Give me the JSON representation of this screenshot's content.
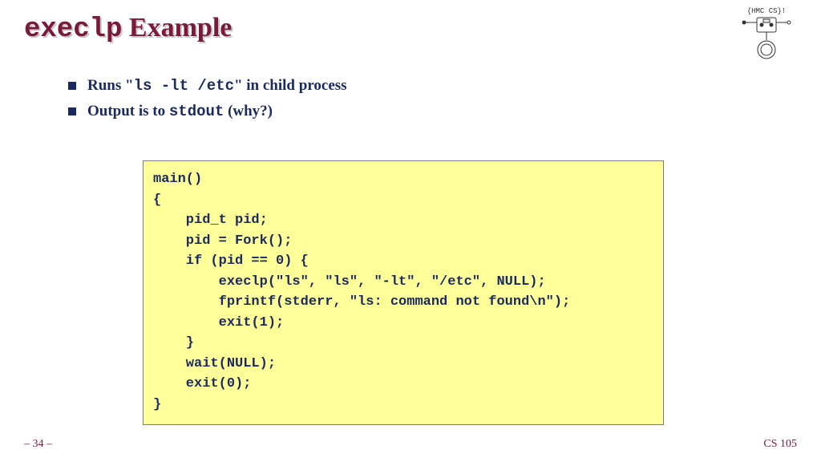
{
  "title": {
    "code_part": "execlp",
    "rest": " Example"
  },
  "bullets": [
    {
      "pre": "Runs \"",
      "mono": "ls -lt /etc",
      "post": "\" in child process"
    },
    {
      "pre": "Output is to ",
      "mono": "stdout",
      "post": " (why?)"
    }
  ],
  "code": "main()\n{\n    pid_t pid;\n    pid = Fork();\n    if (pid == 0) {\n        execlp(\"ls\", \"ls\", \"-lt\", \"/etc\", NULL);\n        fprintf(stderr, \"ls: command not found\\n\");\n        exit(1);\n    }\n    wait(NULL);\n    exit(0);\n}",
  "footer": {
    "left": "– 34 –",
    "right": "CS 105"
  },
  "logo_label": "HMC CS"
}
